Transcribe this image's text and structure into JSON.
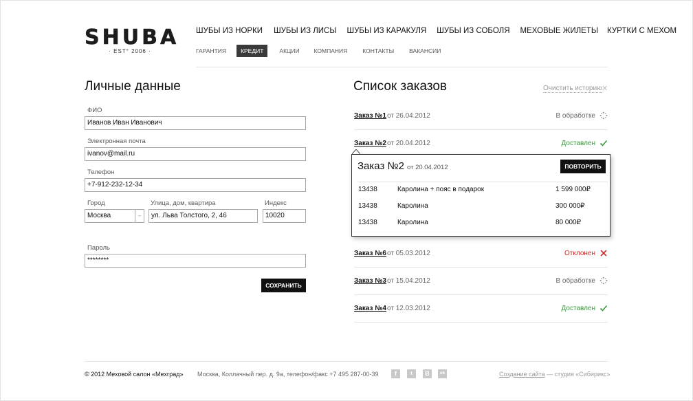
{
  "header": {
    "logo": "SHUBA",
    "logo_est": "· EST° 2006 ·",
    "main_nav": [
      "ШУБЫ ИЗ НОРКИ",
      "ШУБЫ ИЗ ЛИСЫ",
      "ШУБЫ ИЗ КАРАКУЛЯ",
      "ШУБЫ ИЗ СОБОЛЯ",
      "МЕХОВЫЕ ЖИЛЕТЫ",
      "КУРТКИ С МЕХОМ"
    ],
    "sub_nav": [
      "ГАРАНТИЯ",
      "КРЕДИТ",
      "АКЦИИ",
      "КОМПАНИЯ",
      "КОНТАКТЫ",
      "ВАКАНСИИ"
    ],
    "sub_nav_active": "КРЕДИТ"
  },
  "personal": {
    "title": "Личные данные",
    "fio_label": "ФИО",
    "fio_value": "Иванов Иван Иванович",
    "email_label": "Электронная почта",
    "email_value": "ivanov@mail.ru",
    "phone_label": "Телефон",
    "phone_value": "+7-912-232-12-34",
    "city_label": "Город",
    "city_value": "Москва",
    "street_label": "Улица, дом, квартира",
    "street_value": "ул. Льва Толстого, 2, 46",
    "index_label": "Индекс",
    "index_value": "10020",
    "password_label": "Пароль",
    "password_value": "********",
    "save_label": "СОХРАНИТЬ"
  },
  "orders": {
    "title": "Список заказов",
    "clear_label": "Очистить историю",
    "list": [
      {
        "number": "Заказ №1",
        "date": "от 26.04.2012",
        "status": "В обработке",
        "status_color": "#666666",
        "icon": "spinner-icon"
      },
      {
        "number": "Заказ №2",
        "date": "от 20.04.2012",
        "status": "Доставлен",
        "status_color": "#3a9a3a",
        "icon": "check-icon"
      },
      {
        "number": "Заказ №6",
        "date": "от 05.03.2012",
        "status": "Отклонен",
        "status_color": "#cc2a2a",
        "icon": "cross-icon"
      },
      {
        "number": "Заказ №3",
        "date": "от 15.04.2012",
        "status": "В обработке",
        "status_color": "#666666",
        "icon": "spinner-icon"
      },
      {
        "number": "Заказ №4",
        "date": "от 12.03.2012",
        "status": "Доставлен",
        "status_color": "#3a9a3a",
        "icon": "check-icon"
      }
    ],
    "popup": {
      "title": "Заказ №2",
      "date": "от 20.04.2012",
      "repeat_label": "ПОВТОРИТЬ",
      "items": [
        {
          "id": "13438",
          "name": "Каролина + пояс в подарок",
          "price": "1 599 000₽"
        },
        {
          "id": "13438",
          "name": "Каролина",
          "price": "300 000₽"
        },
        {
          "id": "13438",
          "name": "Каролина",
          "price": "80 000₽"
        }
      ]
    }
  },
  "footer": {
    "copyright": "© 2012 Меховой салон «Мехград»",
    "address": "Москва, Коллачный пер. д. 9а, телефон/факс +7 495 287-00-39",
    "social": [
      "f",
      "t",
      "B",
      "ok"
    ],
    "credit_link": "Создание сайта",
    "credit_rest": "— студия «Сибирикс»"
  }
}
